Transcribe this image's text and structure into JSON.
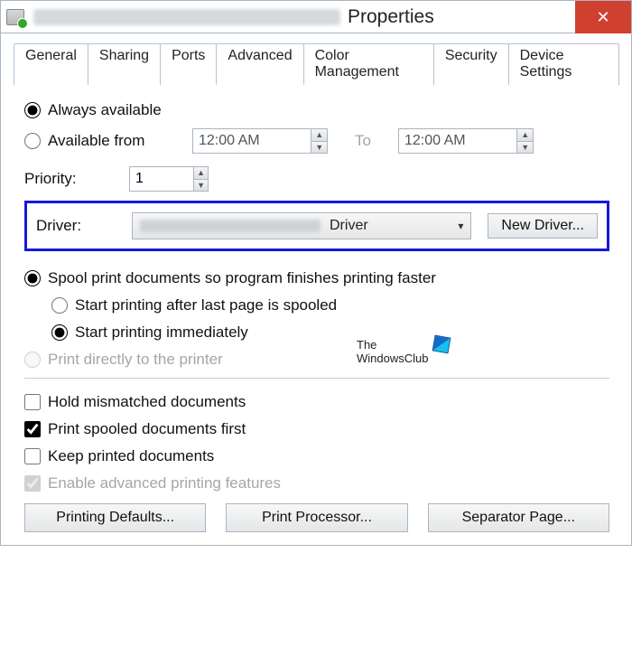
{
  "titlebar": {
    "suffix": "Properties"
  },
  "tabs": {
    "general": "General",
    "sharing": "Sharing",
    "ports": "Ports",
    "advanced": "Advanced",
    "color": "Color Management",
    "security": "Security",
    "device": "Device Settings"
  },
  "availability": {
    "always": "Always available",
    "from": "Available from",
    "start": "12:00 AM",
    "to_label": "To",
    "end": "12:00 AM"
  },
  "priority": {
    "label": "Priority:",
    "value": "1"
  },
  "driver": {
    "label": "Driver:",
    "combo_suffix": "Driver",
    "new_btn": "New Driver..."
  },
  "spool": {
    "main": "Spool print documents so program finishes printing faster",
    "after_last": "Start printing after last page is spooled",
    "immediately": "Start printing immediately",
    "direct": "Print directly to the printer"
  },
  "checks": {
    "hold": "Hold mismatched documents",
    "spooled_first": "Print spooled documents first",
    "keep": "Keep printed documents",
    "enable_adv": "Enable advanced printing features"
  },
  "buttons": {
    "defaults": "Printing Defaults...",
    "processor": "Print Processor...",
    "separator": "Separator Page..."
  },
  "watermark": {
    "line1": "The",
    "line2": "WindowsClub"
  }
}
